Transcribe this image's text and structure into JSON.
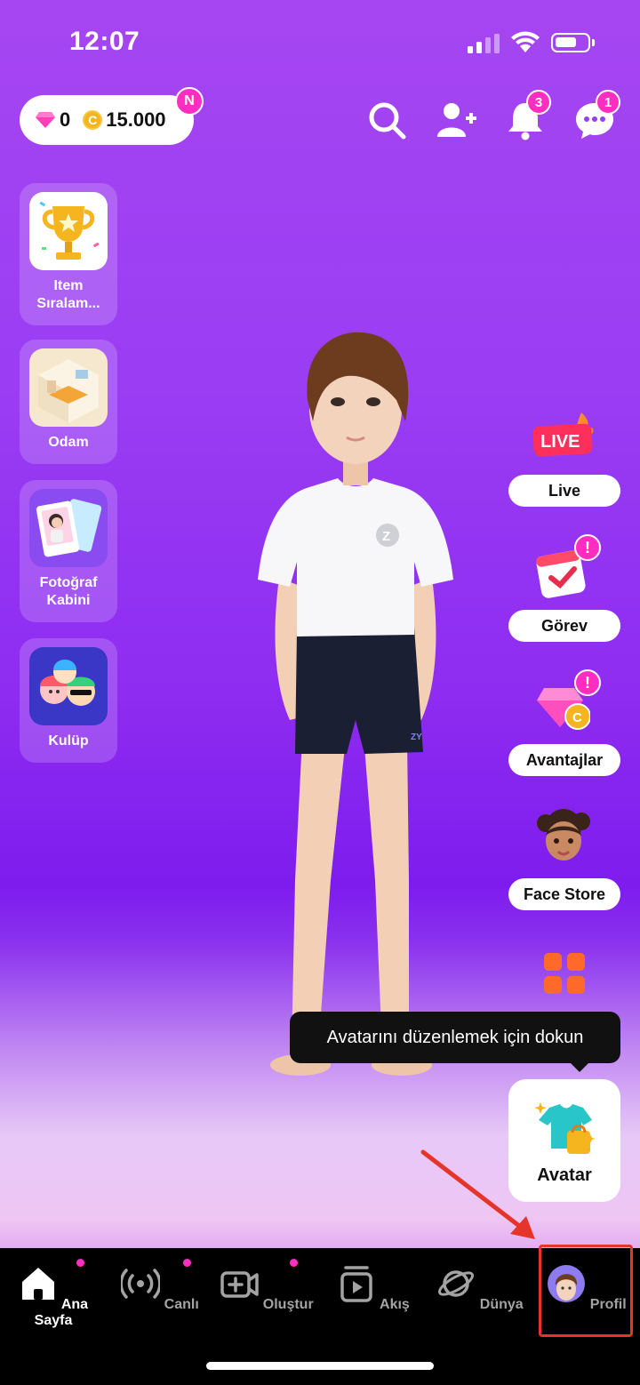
{
  "status_bar": {
    "time": "12:07"
  },
  "header": {
    "gems": "0",
    "coins": "15.000",
    "new_badge": "N",
    "notifications_count": "3",
    "messages_count": "1"
  },
  "left_menu": [
    {
      "label_line1": "Item",
      "label_line2": "Sıralam..."
    },
    {
      "label_line1": "Odam",
      "label_line2": ""
    },
    {
      "label_line1": "Fotoğraf",
      "label_line2": "Kabini"
    },
    {
      "label_line1": "Kulüp",
      "label_line2": ""
    }
  ],
  "right_menu": {
    "live_sticker": "LIVE",
    "live": "Live",
    "gorev": "Görev",
    "avantajlar": "Avantajlar",
    "face_store": "Face Store",
    "avatar": "Avatar",
    "alert": "!",
    "coin_letter": "C"
  },
  "avatar_shirt_logo": "Z",
  "tooltip": "Avatarını düzenlemek için dokun",
  "tab_bar": {
    "items": [
      {
        "label": "Ana Sayfa"
      },
      {
        "label": "Canlı"
      },
      {
        "label": "Oluştur"
      },
      {
        "label": "Akış"
      },
      {
        "label": "Dünya"
      },
      {
        "label": "Profil"
      }
    ]
  },
  "colors": {
    "accent_pink": "#ff2ec1",
    "highlight_red": "#e5352b",
    "coin_gold": "#f5b51f"
  }
}
